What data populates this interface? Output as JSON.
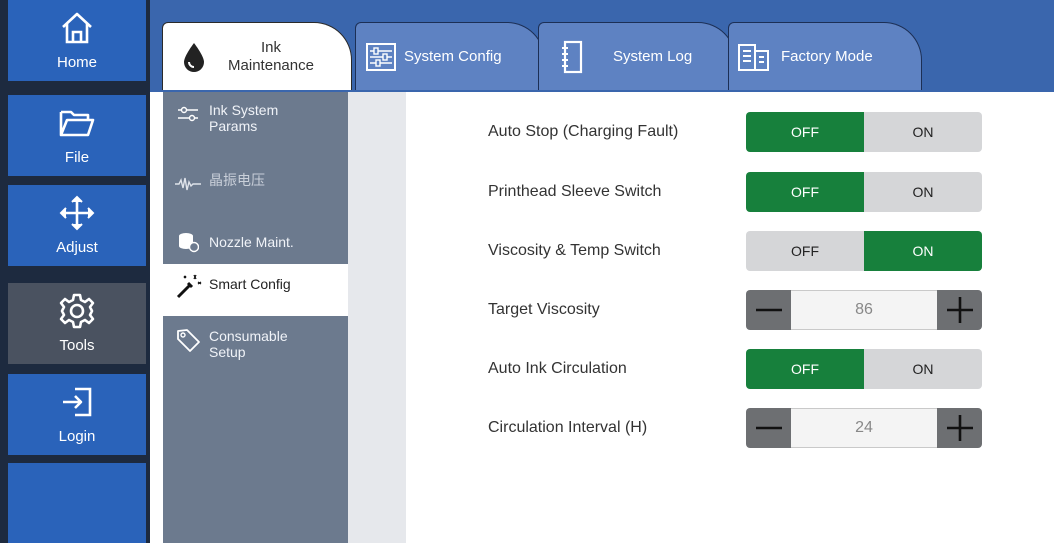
{
  "nav": {
    "items": [
      {
        "label": "Home",
        "icon": "home-icon"
      },
      {
        "label": "File",
        "icon": "folder-icon"
      },
      {
        "label": "Adjust",
        "icon": "move-arrows-icon"
      },
      {
        "label": "Tools",
        "icon": "gear-icon"
      },
      {
        "label": "Login",
        "icon": "login-icon"
      }
    ],
    "active": "Tools"
  },
  "tabs": [
    {
      "label": "Ink\nMaintenance",
      "icon": "ink-drop-icon",
      "active": true
    },
    {
      "label": "System Config",
      "icon": "sliders-icon",
      "active": false
    },
    {
      "label": "System Log",
      "icon": "notebook-icon",
      "active": false
    },
    {
      "label": "Factory Mode",
      "icon": "building-icon",
      "active": false
    }
  ],
  "submenu": [
    {
      "label": "Ink System\nParams",
      "icon": "params-icon",
      "active": false
    },
    {
      "label": "晶振电压",
      "icon": "waveform-icon",
      "active": false
    },
    {
      "label": "Nozzle Maint.",
      "icon": "nozzle-icon",
      "active": false
    },
    {
      "label": "Smart Config",
      "icon": "magic-wand-icon",
      "active": true
    },
    {
      "label": "Consumable\nSetup",
      "icon": "tag-icon",
      "active": false
    }
  ],
  "settings": [
    {
      "label": "Auto Stop (Charging Fault)",
      "type": "toggle",
      "off_label": "OFF",
      "on_label": "ON",
      "value": "OFF"
    },
    {
      "label": "Printhead Sleeve Switch",
      "type": "toggle",
      "off_label": "OFF",
      "on_label": "ON",
      "value": "OFF"
    },
    {
      "label": "Viscosity & Temp Switch",
      "type": "toggle",
      "off_label": "OFF",
      "on_label": "ON",
      "value": "ON"
    },
    {
      "label": "Target Viscosity",
      "type": "stepper",
      "value": "86"
    },
    {
      "label": "Auto Ink Circulation",
      "type": "toggle",
      "off_label": "OFF",
      "on_label": "ON",
      "value": "OFF"
    },
    {
      "label": "Circulation Interval (H)",
      "type": "stepper",
      "value": "24"
    }
  ],
  "colors": {
    "nav_blue": "#2a63ba",
    "nav_active": "#4a5260",
    "toggle_active_green": "#17803c",
    "toggle_inactive": "#d5d6d8",
    "stepper_button": "#6d6f72"
  }
}
